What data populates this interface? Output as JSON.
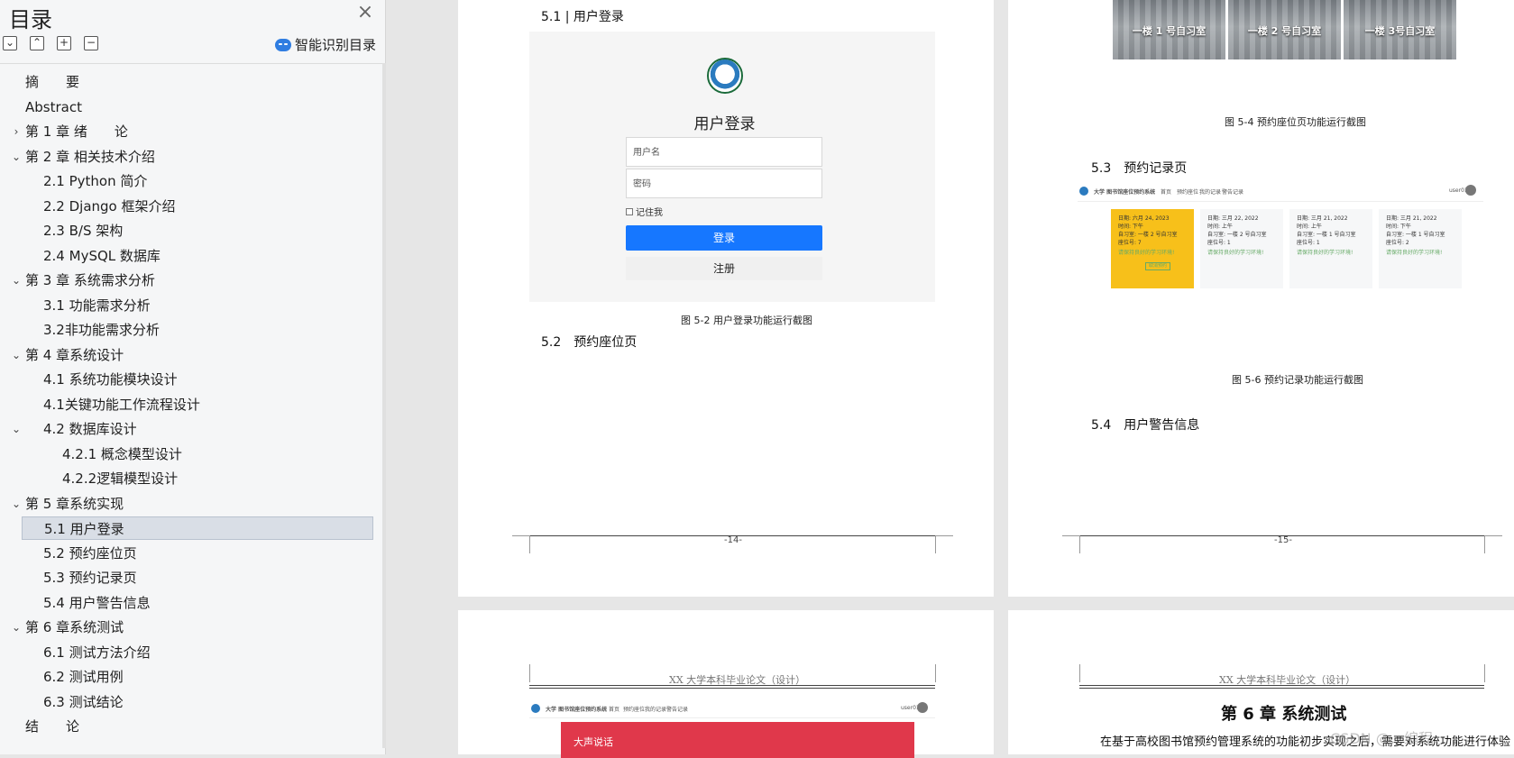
{
  "sidebar": {
    "title": "目录",
    "smart_toc_label": "智能识别目录",
    "tools": [
      "collapse-all",
      "expand-all",
      "expand-level",
      "collapse-level"
    ],
    "items": [
      {
        "label": "摘　　要",
        "level": 0,
        "chev": ""
      },
      {
        "label": "Abstract",
        "level": 0,
        "chev": ""
      },
      {
        "label": "第 1 章  绪　　论",
        "level": 0,
        "chev": "›"
      },
      {
        "label": "第 2 章  相关技术介绍",
        "level": 0,
        "chev": "⌄"
      },
      {
        "label": "2.1  Python 简介",
        "level": 1,
        "chev": ""
      },
      {
        "label": "2.2  Django 框架介绍",
        "level": 1,
        "chev": ""
      },
      {
        "label": "2.3  B/S 架构",
        "level": 1,
        "chev": ""
      },
      {
        "label": "2.4  MySQL 数据库",
        "level": 1,
        "chev": ""
      },
      {
        "label": "第 3 章  系统需求分析",
        "level": 0,
        "chev": "⌄"
      },
      {
        "label": "3.1  功能需求分析",
        "level": 1,
        "chev": ""
      },
      {
        "label": "3.2非功能需求分析",
        "level": 1,
        "chev": ""
      },
      {
        "label": "第 4 章系统设计",
        "level": 0,
        "chev": "⌄"
      },
      {
        "label": "4.1  系统功能模块设计",
        "level": 1,
        "chev": ""
      },
      {
        "label": "4.1关键功能工作流程设计",
        "level": 1,
        "chev": ""
      },
      {
        "label": "4.2  数据库设计",
        "level": 1,
        "chev": "⌄"
      },
      {
        "label": "4.2.1  概念模型设计",
        "level": 2,
        "chev": ""
      },
      {
        "label": "4.2.2逻辑模型设计",
        "level": 2,
        "chev": ""
      },
      {
        "label": "第 5 章系统实现",
        "level": 0,
        "chev": "⌄"
      },
      {
        "label": "5.1  用户登录",
        "level": 1,
        "chev": "",
        "selected": true
      },
      {
        "label": "5.2  预约座位页",
        "level": 1,
        "chev": ""
      },
      {
        "label": "5.3  预约记录页",
        "level": 1,
        "chev": ""
      },
      {
        "label": "5.4  用户警告信息",
        "level": 1,
        "chev": ""
      },
      {
        "label": "第 6 章系统测试",
        "level": 0,
        "chev": "⌄"
      },
      {
        "label": "6.1  测试方法介绍",
        "level": 1,
        "chev": ""
      },
      {
        "label": "6.2  测试用例",
        "level": 1,
        "chev": ""
      },
      {
        "label": "6.3  测试结论",
        "level": 1,
        "chev": ""
      },
      {
        "label": "结　　论",
        "level": 0,
        "chev": ""
      }
    ]
  },
  "page14": {
    "section_5_1": "5.1 | 用户登录",
    "login": {
      "title": "用户登录",
      "username_placeholder": "用户名",
      "password_placeholder": "密码",
      "remember": "记住我",
      "login_btn": "登录",
      "register_btn": "注册"
    },
    "caption_5_2": "图 5-2  用户登录功能运行截图",
    "section_5_2": "5.2　预约座位页",
    "page_number": "-14-"
  },
  "page15": {
    "photos": [
      "一楼 1 号自习室",
      "一楼 2 号自习室",
      "一楼 3号自习室"
    ],
    "caption_5_4": "图 5-4  预约座位页功能运行截图",
    "section_5_3": "5.3　预约记录页",
    "rec_nav": {
      "brand": "大学 图书馆座位预约系统",
      "links": [
        "首页",
        "预约座位",
        "我的记录",
        "警告记录"
      ],
      "user": "user01"
    },
    "records": [
      {
        "date": "日期:  六月 24, 2023",
        "time": "时间:  下午",
        "room": "自习室:  一楼 2 号自习室",
        "seat": "座位号:  7",
        "tip": "请保持良好的学习环境!",
        "cancel": "取消预约",
        "active": true
      },
      {
        "date": "日期:  三月 22, 2022",
        "time": "时间:  上午",
        "room": "自习室:  一楼 2 号自习室",
        "seat": "座位号:  1",
        "tip": "请保持良好的学习环境!",
        "cancel": "",
        "active": false
      },
      {
        "date": "日期:  三月 21, 2022",
        "time": "时间:  上午",
        "room": "自习室:  一楼 1 号自习室",
        "seat": "座位号:  1",
        "tip": "请保持良好的学习环境!",
        "cancel": "",
        "active": false
      },
      {
        "date": "日期:  三月 21, 2022",
        "time": "时间:  下午",
        "room": "自习室:  一楼 1 号自习室",
        "seat": "座位号:  2",
        "tip": "请保持良好的学习环境!",
        "cancel": "",
        "active": false
      }
    ],
    "caption_5_6": "图 5-6  预约记录功能运行截图",
    "section_5_4": "5.4　用户警告信息",
    "page_number": "-15-"
  },
  "page16": {
    "header": "XX 大学本科毕业论文（设计）",
    "nav": {
      "brand": "大学 图书馆座位预约系统",
      "links": [
        "首页",
        "预约座位",
        "我的记录",
        "警告记录"
      ],
      "user": "user01"
    },
    "banner_title": "大声说话"
  },
  "page17": {
    "header": "XX 大学本科毕业论文（设计）",
    "chapter_title": "第 6 章  系统测试",
    "body_text": "在基于高校图书馆预约管理系统的功能初步实现之后，需要对系统功能进行体验"
  },
  "watermark": "CSDN @...编程"
}
